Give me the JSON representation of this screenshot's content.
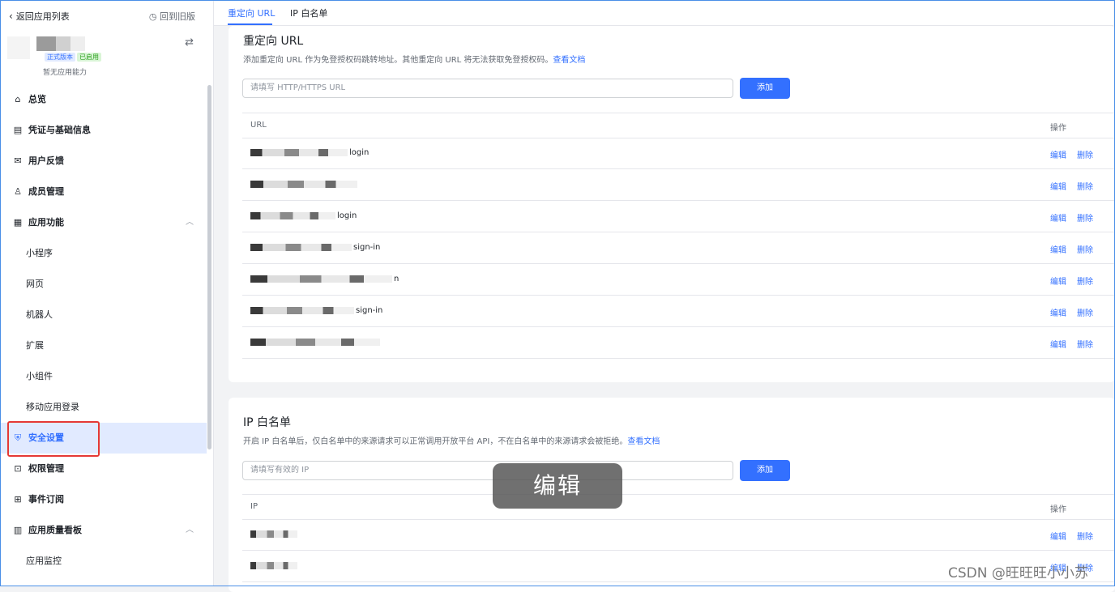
{
  "sidebar": {
    "back_label": "返回应用列表",
    "old_version_label": "回到旧版",
    "app": {
      "version_tag": "正式版本",
      "status_tag": "已启用",
      "ability_text": "暂无应用能力"
    },
    "items": [
      {
        "label": "总览",
        "icon": "home-icon"
      },
      {
        "label": "凭证与基础信息",
        "icon": "credential-icon"
      },
      {
        "label": "用户反馈",
        "icon": "mail-icon"
      },
      {
        "label": "成员管理",
        "icon": "person-icon"
      },
      {
        "label": "应用功能",
        "icon": "grid-icon"
      },
      {
        "label": "小程序"
      },
      {
        "label": "网页"
      },
      {
        "label": "机器人"
      },
      {
        "label": "扩展"
      },
      {
        "label": "小组件"
      },
      {
        "label": "移动应用登录"
      },
      {
        "label": "安全设置",
        "icon": "shield-icon"
      },
      {
        "label": "权限管理",
        "icon": "permission-icon"
      },
      {
        "label": "事件订阅",
        "icon": "event-icon"
      },
      {
        "label": "应用质量看板",
        "icon": "chart-icon"
      },
      {
        "label": "应用监控"
      }
    ]
  },
  "tabs": [
    {
      "label": "重定向 URL"
    },
    {
      "label": "IP 白名单"
    }
  ],
  "redirect": {
    "title": "重定向 URL",
    "desc": "添加重定向 URL 作为免登授权码跳转地址。其他重定向 URL 将无法获取免登授权码。",
    "doc_link": "查看文档",
    "placeholder": "请填写 HTTP/HTTPS URL",
    "add_label": "添加",
    "col_url": "URL",
    "col_action": "操作",
    "rows": [
      {
        "suffix": "login"
      },
      {
        "suffix": ""
      },
      {
        "suffix": "login"
      },
      {
        "suffix": "sign-in"
      },
      {
        "suffix": "n"
      },
      {
        "suffix": "sign-in"
      },
      {
        "suffix": ""
      }
    ],
    "edit_label": "编辑",
    "delete_label": "删除"
  },
  "ip": {
    "title": "IP 白名单",
    "desc": "开启 IP 白名单后，仅白名单中的来源请求可以正常调用开放平台 API，不在白名单中的来源请求会被拒绝。",
    "doc_link": "查看文档",
    "placeholder": "请填写有效的 IP",
    "add_label": "添加",
    "col_ip": "IP",
    "col_action": "操作",
    "edit_label": "编辑",
    "delete_label": "删除"
  },
  "toast": "编辑",
  "watermark": "CSDN @旺旺旺小小苏"
}
